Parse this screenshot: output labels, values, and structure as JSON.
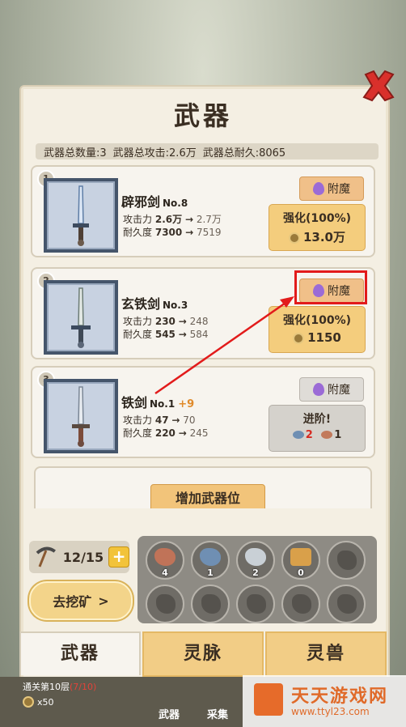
{
  "title": "武器",
  "stats": {
    "count": "武器总数量:3",
    "attack": "武器总攻击:2.6万",
    "durability": "武器总耐久:8065"
  },
  "weapons": [
    {
      "index": "1",
      "name": "辟邪剑",
      "no": "No.8",
      "bonus": "",
      "atk_label": "攻击力",
      "atk_cur": "2.6万",
      "atk_next": "2.7万",
      "dur_label": "耐久度",
      "dur_cur": "7300",
      "dur_next": "7519",
      "enchant": "附魔",
      "upgrade_label": "强化(100%)",
      "upgrade_cost": "13.0万"
    },
    {
      "index": "2",
      "name": "玄铁剑",
      "no": "No.3",
      "bonus": "",
      "atk_label": "攻击力",
      "atk_cur": "230",
      "atk_next": "248",
      "dur_label": "耐久度",
      "dur_cur": "545",
      "dur_next": "584",
      "enchant": "附魔",
      "upgrade_label": "强化(100%)",
      "upgrade_cost": "1150"
    },
    {
      "index": "3",
      "name": "铁剑",
      "no": "No.1",
      "bonus": "+9",
      "atk_label": "攻击力",
      "atk_cur": "47",
      "atk_next": "70",
      "dur_label": "耐久度",
      "dur_cur": "220",
      "dur_next": "245",
      "enchant": "附魔",
      "upgrade_label": "进阶!",
      "req_blue": "2",
      "req_red": "1"
    }
  ],
  "arrow": "→",
  "add_slot": "增加武器位",
  "pickaxe": "12/15",
  "mine_button": "去挖矿",
  "ores": [
    "4",
    "1",
    "2",
    "0"
  ],
  "tabs": [
    "武器",
    "灵脉",
    "灵兽"
  ],
  "bottom": {
    "stage": "通关第10层",
    "stage_progress": "(7/10)",
    "reward": "x50",
    "nav1": "武器",
    "nav2": "采集"
  },
  "watermark": {
    "title": "天天游戏网",
    "url": "www.ttyl23.com"
  },
  "colors": {
    "accent": "#f2c47a",
    "annotation": "#e21b1b"
  }
}
